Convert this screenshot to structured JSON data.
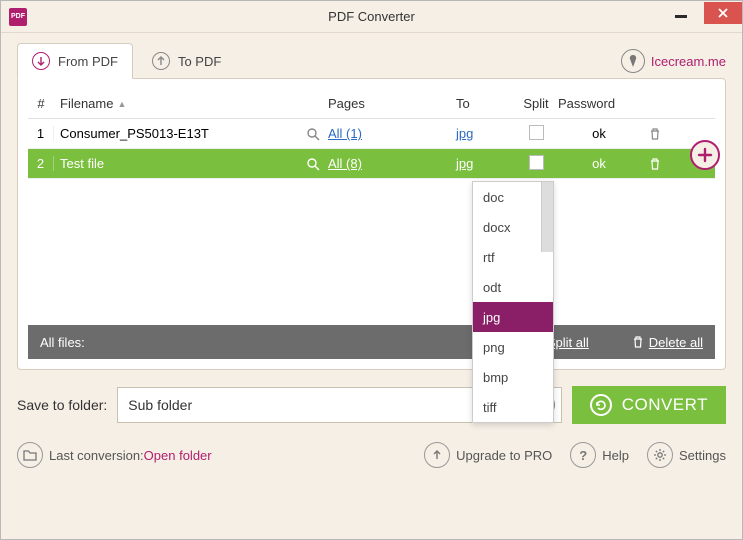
{
  "window": {
    "title": "PDF Converter"
  },
  "tabs": {
    "from": "From PDF",
    "to": "To PDF"
  },
  "brand": {
    "label": "Icecream.me"
  },
  "table": {
    "headers": {
      "num": "#",
      "filename": "Filename",
      "pages": "Pages",
      "to": "To",
      "split": "Split",
      "password": "Password"
    },
    "rows": [
      {
        "num": "1",
        "filename": "Consumer_PS5013-E13T",
        "pages": "All (1)",
        "to": "jpg",
        "password": "ok"
      },
      {
        "num": "2",
        "filename": "Test file",
        "pages": "All (8)",
        "to": "jpg",
        "password": "ok"
      }
    ]
  },
  "allfiles": {
    "label": "All files:",
    "split_all": "Split all",
    "delete_all": "Delete all"
  },
  "dropdown": {
    "options": [
      "doc",
      "docx",
      "rtf",
      "odt",
      "jpg",
      "png",
      "bmp",
      "tiff"
    ],
    "selected": "jpg"
  },
  "save": {
    "label": "Save to folder:",
    "value": "Sub folder"
  },
  "convert": {
    "label": "CONVERT"
  },
  "footer": {
    "last_conversion_prefix": "Last conversion: ",
    "open_folder": "Open folder",
    "upgrade": "Upgrade to PRO",
    "help": "Help",
    "settings": "Settings"
  }
}
